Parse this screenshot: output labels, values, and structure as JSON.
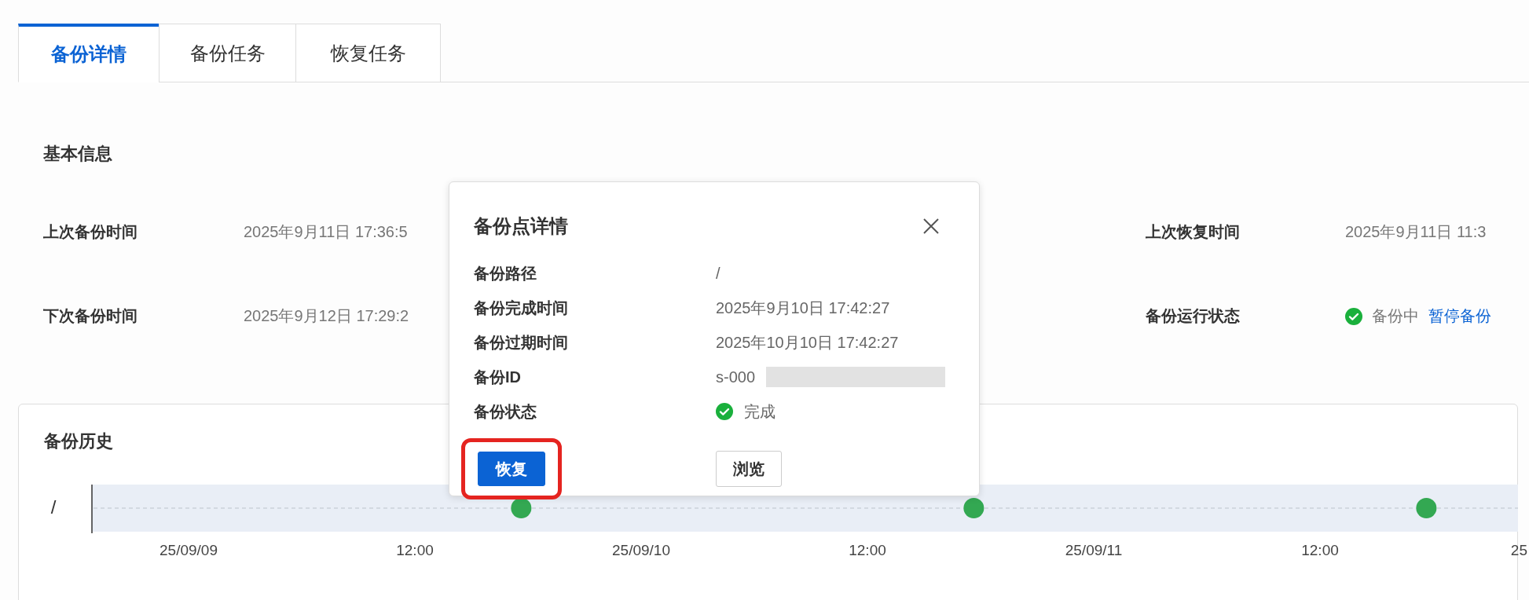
{
  "tabs": [
    {
      "label": "备份详情",
      "selected": true
    },
    {
      "label": "备份任务",
      "selected": false
    },
    {
      "label": "恢复任务",
      "selected": false
    }
  ],
  "basic_info": {
    "title": "基本信息",
    "fields": [
      {
        "label": "上次备份时间",
        "value": "2025年9月11日 17:36:5"
      },
      {
        "label": "上次恢复时间",
        "value": "2025年9月11日 11:3"
      },
      {
        "label": "下次备份时间",
        "value": "2025年9月12日 17:29:2"
      },
      {
        "label": "备份运行状态",
        "value": "备份中",
        "success": true,
        "link": "暂停备份"
      }
    ]
  },
  "history": {
    "title": "备份历史",
    "timeline": {
      "row_label": "/",
      "tick_labels": [
        "25/09/09",
        "12:00",
        "25/09/10",
        "12:00",
        "25/09/11",
        "12:00",
        "25"
      ],
      "points": [
        {
          "success": true
        },
        {
          "success": true
        },
        {
          "success": true
        }
      ]
    }
  },
  "popup": {
    "title": "备份点详情",
    "rows": [
      {
        "label": "备份路径",
        "value": "/"
      },
      {
        "label": "备份完成时间",
        "value": "2025年9月10日 17:42:27"
      },
      {
        "label": "备份过期时间",
        "value": "2025年10月10日 17:42:27"
      },
      {
        "label": "备份ID",
        "value": "s-000",
        "redacted": true
      },
      {
        "label": "备份状态",
        "value": "完成",
        "success": true
      }
    ],
    "buttons": [
      {
        "label": "恢复",
        "kind": "primary",
        "highlighted": true
      },
      {
        "label": "浏览",
        "kind": "default",
        "highlighted": false
      }
    ]
  }
}
